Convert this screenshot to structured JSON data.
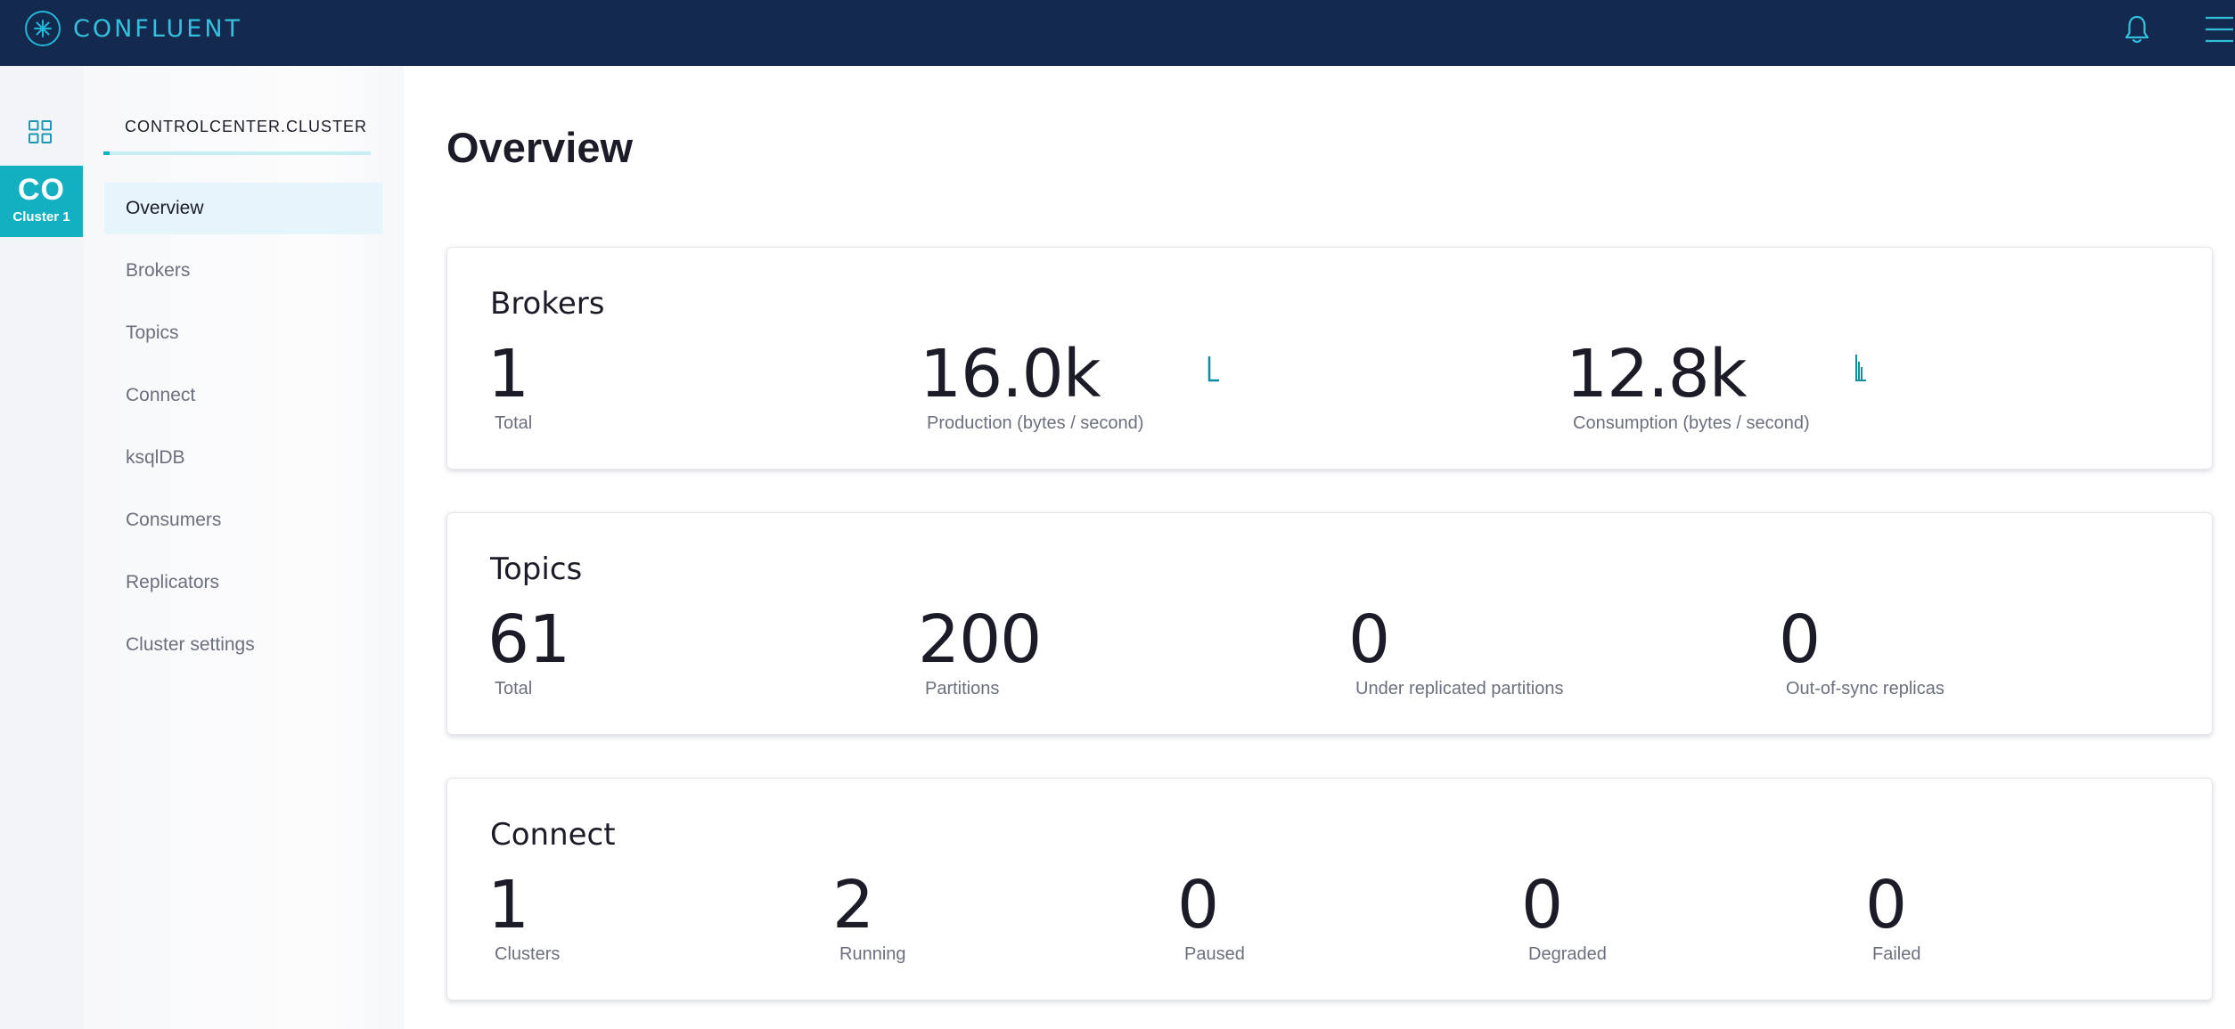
{
  "header": {
    "logo_text": "CONFLUENT",
    "icons": [
      "confluent-logo-icon",
      "bell-icon",
      "hamburger-menu-icon"
    ],
    "brand_color": "#132a4e",
    "accent_color": "#12b0c0"
  },
  "rail": {
    "icons": [
      "grid-icon"
    ],
    "cluster_abbr": "CO",
    "cluster_name": "Cluster 1"
  },
  "nav": {
    "header": "CONTROLCENTER.CLUSTER",
    "items": [
      {
        "label": "Overview",
        "active": true
      },
      {
        "label": "Brokers"
      },
      {
        "label": "Topics"
      },
      {
        "label": "Connect"
      },
      {
        "label": "ksqlDB"
      },
      {
        "label": "Consumers"
      },
      {
        "label": "Replicators"
      },
      {
        "label": "Cluster settings"
      }
    ]
  },
  "main": {
    "title": "Overview",
    "cards": {
      "brokers": {
        "title": "Brokers",
        "metrics": [
          {
            "value": "1",
            "label": "Total"
          },
          {
            "value": "16.0k",
            "label": "Production (bytes / second)"
          },
          {
            "value": "12.8k",
            "label": "Consumption (bytes / second)"
          }
        ]
      },
      "topics": {
        "title": "Topics",
        "metrics": [
          {
            "value": "61",
            "label": "Total"
          },
          {
            "value": "200",
            "label": "Partitions"
          },
          {
            "value": "0",
            "label": "Under replicated partitions"
          },
          {
            "value": "0",
            "label": "Out-of-sync replicas"
          }
        ]
      },
      "connect": {
        "title": "Connect",
        "metrics": [
          {
            "value": "1",
            "label": "Clusters"
          },
          {
            "value": "2",
            "label": "Running"
          },
          {
            "value": "0",
            "label": "Paused"
          },
          {
            "value": "0",
            "label": "Degraded"
          },
          {
            "value": "0",
            "label": "Failed"
          }
        ]
      }
    }
  }
}
